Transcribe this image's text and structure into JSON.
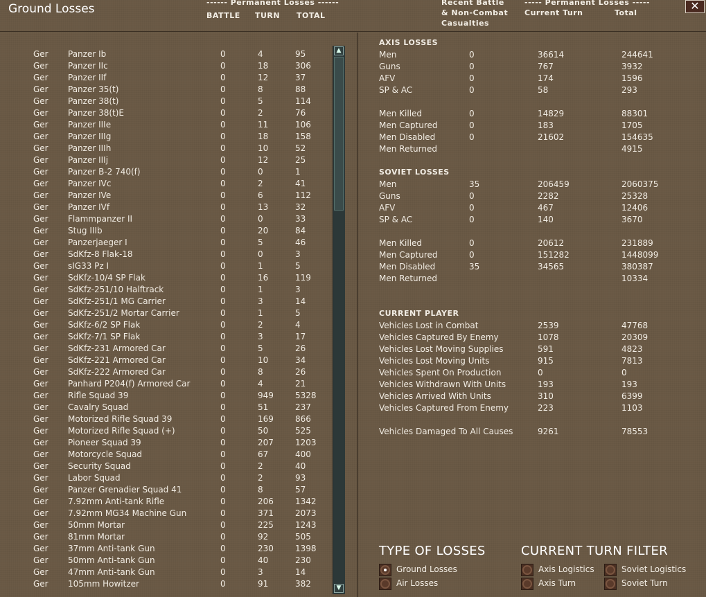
{
  "title": "Ground Losses",
  "headers": {
    "perm_left": "------ Permanent Losses ------",
    "battle": "BATTLE",
    "turn": "TURN",
    "total": "TOTAL",
    "recent_1": "Recent Battle",
    "recent_2": "& Non-Combat",
    "recent_3": "Casualties",
    "perm_right": "----- Permanent Losses -----",
    "current_turn": "Current Turn",
    "total_right": "Total"
  },
  "close_label": "✕",
  "scroll": {
    "up": "▲",
    "down": "▼"
  },
  "units": [
    {
      "nat": "Ger",
      "name": "Panzer Ib",
      "battle": "0",
      "turn": "4",
      "total": "95"
    },
    {
      "nat": "Ger",
      "name": "Panzer IIc",
      "battle": "0",
      "turn": "18",
      "total": "306"
    },
    {
      "nat": "Ger",
      "name": "Panzer IIf",
      "battle": "0",
      "turn": "12",
      "total": "37"
    },
    {
      "nat": "Ger",
      "name": "Panzer 35(t)",
      "battle": "0",
      "turn": "8",
      "total": "88"
    },
    {
      "nat": "Ger",
      "name": "Panzer 38(t)",
      "battle": "0",
      "turn": "5",
      "total": "114"
    },
    {
      "nat": "Ger",
      "name": "Panzer 38(t)E",
      "battle": "0",
      "turn": "2",
      "total": "76"
    },
    {
      "nat": "Ger",
      "name": "Panzer IIIe",
      "battle": "0",
      "turn": "11",
      "total": "106"
    },
    {
      "nat": "Ger",
      "name": "Panzer IIIg",
      "battle": "0",
      "turn": "18",
      "total": "158"
    },
    {
      "nat": "Ger",
      "name": "Panzer IIIh",
      "battle": "0",
      "turn": "10",
      "total": "52"
    },
    {
      "nat": "Ger",
      "name": "Panzer IIIj",
      "battle": "0",
      "turn": "12",
      "total": "25"
    },
    {
      "nat": "Ger",
      "name": "Panzer B-2 740(f)",
      "battle": "0",
      "turn": "0",
      "total": "1"
    },
    {
      "nat": "Ger",
      "name": "Panzer IVc",
      "battle": "0",
      "turn": "2",
      "total": "41"
    },
    {
      "nat": "Ger",
      "name": "Panzer IVe",
      "battle": "0",
      "turn": "6",
      "total": "112"
    },
    {
      "nat": "Ger",
      "name": "Panzer IVf",
      "battle": "0",
      "turn": "13",
      "total": "32"
    },
    {
      "nat": "Ger",
      "name": "Flammpanzer II",
      "battle": "0",
      "turn": "0",
      "total": "33"
    },
    {
      "nat": "Ger",
      "name": "Stug IIIb",
      "battle": "0",
      "turn": "20",
      "total": "84"
    },
    {
      "nat": "Ger",
      "name": "Panzerjaeger I",
      "battle": "0",
      "turn": "5",
      "total": "46"
    },
    {
      "nat": "Ger",
      "name": "SdKfz-8 Flak-18",
      "battle": "0",
      "turn": "0",
      "total": "3"
    },
    {
      "nat": "Ger",
      "name": "sIG33 Pz I",
      "battle": "0",
      "turn": "1",
      "total": "5"
    },
    {
      "nat": "Ger",
      "name": "SdKfz-10/4 SP Flak",
      "battle": "0",
      "turn": "16",
      "total": "119"
    },
    {
      "nat": "Ger",
      "name": "SdKfz-251/10 Halftrack",
      "battle": "0",
      "turn": "1",
      "total": "3"
    },
    {
      "nat": "Ger",
      "name": "SdKfz-251/1 MG Carrier",
      "battle": "0",
      "turn": "3",
      "total": "14"
    },
    {
      "nat": "Ger",
      "name": "SdKfz-251/2 Mortar Carrier",
      "battle": "0",
      "turn": "1",
      "total": "5"
    },
    {
      "nat": "Ger",
      "name": "SdKfz-6/2 SP Flak",
      "battle": "0",
      "turn": "2",
      "total": "4"
    },
    {
      "nat": "Ger",
      "name": "SdKfz-7/1 SP Flak",
      "battle": "0",
      "turn": "3",
      "total": "17"
    },
    {
      "nat": "Ger",
      "name": "SdKfz-231 Armored Car",
      "battle": "0",
      "turn": "5",
      "total": "26"
    },
    {
      "nat": "Ger",
      "name": "SdKfz-221 Armored Car",
      "battle": "0",
      "turn": "10",
      "total": "34"
    },
    {
      "nat": "Ger",
      "name": "SdKfz-222 Armored Car",
      "battle": "0",
      "turn": "8",
      "total": "26"
    },
    {
      "nat": "Ger",
      "name": "Panhard P204(f) Armored Car",
      "battle": "0",
      "turn": "4",
      "total": "21"
    },
    {
      "nat": "Ger",
      "name": "Rifle Squad 39",
      "battle": "0",
      "turn": "949",
      "total": "5328"
    },
    {
      "nat": "Ger",
      "name": "Cavalry Squad",
      "battle": "0",
      "turn": "51",
      "total": "237"
    },
    {
      "nat": "Ger",
      "name": "Motorized Rifle Squad 39",
      "battle": "0",
      "turn": "169",
      "total": "866"
    },
    {
      "nat": "Ger",
      "name": "Motorized Rifle Squad (+)",
      "battle": "0",
      "turn": "50",
      "total": "525"
    },
    {
      "nat": "Ger",
      "name": "Pioneer Squad 39",
      "battle": "0",
      "turn": "207",
      "total": "1203"
    },
    {
      "nat": "Ger",
      "name": "Motorcycle Squad",
      "battle": "0",
      "turn": "67",
      "total": "400"
    },
    {
      "nat": "Ger",
      "name": "Security Squad",
      "battle": "0",
      "turn": "2",
      "total": "40"
    },
    {
      "nat": "Ger",
      "name": "Labor Squad",
      "battle": "0",
      "turn": "2",
      "total": "93"
    },
    {
      "nat": "Ger",
      "name": "Panzer Grenadier Squad 41",
      "battle": "0",
      "turn": "8",
      "total": "57"
    },
    {
      "nat": "Ger",
      "name": "7.92mm Anti-tank Rifle",
      "battle": "0",
      "turn": "206",
      "total": "1342"
    },
    {
      "nat": "Ger",
      "name": "7.92mm MG34 Machine Gun",
      "battle": "0",
      "turn": "371",
      "total": "2073"
    },
    {
      "nat": "Ger",
      "name": "50mm Mortar",
      "battle": "0",
      "turn": "225",
      "total": "1243"
    },
    {
      "nat": "Ger",
      "name": "81mm Mortar",
      "battle": "0",
      "turn": "92",
      "total": "505"
    },
    {
      "nat": "Ger",
      "name": "37mm Anti-tank Gun",
      "battle": "0",
      "turn": "230",
      "total": "1398"
    },
    {
      "nat": "Ger",
      "name": "50mm Anti-tank Gun",
      "battle": "0",
      "turn": "40",
      "total": "230"
    },
    {
      "nat": "Ger",
      "name": "47mm Anti-tank Gun",
      "battle": "0",
      "turn": "3",
      "total": "14"
    },
    {
      "nat": "Ger",
      "name": "105mm Howitzer",
      "battle": "0",
      "turn": "91",
      "total": "382"
    }
  ],
  "axis": {
    "title": "AXIS LOSSES",
    "rows": [
      {
        "label": "Men",
        "recent": "0",
        "current": "36614",
        "total": "244641"
      },
      {
        "label": "Guns",
        "recent": "0",
        "current": "767",
        "total": "3932"
      },
      {
        "label": "AFV",
        "recent": "0",
        "current": "174",
        "total": "1596"
      },
      {
        "label": "SP & AC",
        "recent": "0",
        "current": "58",
        "total": "293"
      },
      {
        "label": "Men Killed",
        "recent": "0",
        "current": "14829",
        "total": "88301"
      },
      {
        "label": "Men Captured",
        "recent": "0",
        "current": "183",
        "total": "1705"
      },
      {
        "label": "Men Disabled",
        "recent": "0",
        "current": "21602",
        "total": "154635"
      },
      {
        "label": "Men Returned",
        "recent": "",
        "current": "",
        "total": "4915"
      }
    ]
  },
  "soviet": {
    "title": "SOVIET LOSSES",
    "rows": [
      {
        "label": "Men",
        "recent": "35",
        "current": "206459",
        "total": "2060375"
      },
      {
        "label": "Guns",
        "recent": "0",
        "current": "2282",
        "total": "25328"
      },
      {
        "label": "AFV",
        "recent": "0",
        "current": "467",
        "total": "12406"
      },
      {
        "label": "SP & AC",
        "recent": "0",
        "current": "140",
        "total": "3670"
      },
      {
        "label": "Men Killed",
        "recent": "0",
        "current": "20612",
        "total": "231889"
      },
      {
        "label": "Men Captured",
        "recent": "0",
        "current": "151282",
        "total": "1448099"
      },
      {
        "label": "Men Disabled",
        "recent": "35",
        "current": "34565",
        "total": "380387"
      },
      {
        "label": "Men Returned",
        "recent": "",
        "current": "",
        "total": "10334"
      }
    ]
  },
  "player": {
    "title": "CURRENT PLAYER",
    "rows": [
      {
        "label": "Vehicles Lost in Combat",
        "current": "2539",
        "total": "47768"
      },
      {
        "label": "Vehicles Captured By Enemy",
        "current": "1078",
        "total": "20309"
      },
      {
        "label": "Vehicles Lost Moving Supplies",
        "current": "591",
        "total": "4823"
      },
      {
        "label": "Vehicles Lost Moving Units",
        "current": "915",
        "total": "7813"
      },
      {
        "label": "Vehicles Spent On Production",
        "current": "0",
        "total": "0"
      },
      {
        "label": "Vehicles Withdrawn With Units",
        "current": "193",
        "total": "193"
      },
      {
        "label": "Vehicles Arrived With Units",
        "current": "310",
        "total": "6399"
      },
      {
        "label": "Vehicles Captured From Enemy",
        "current": "223",
        "total": "1103"
      },
      {
        "label": "Vehicles Damaged To All Causes",
        "current": "9261",
        "total": "78553"
      }
    ]
  },
  "type_of_losses": {
    "title": "TYPE OF LOSSES",
    "options": [
      "Ground Losses",
      "Air Losses"
    ],
    "selected": "Ground Losses"
  },
  "turn_filter": {
    "title": "CURRENT TURN FILTER",
    "options": [
      "Axis Logistics",
      "Soviet Logistics",
      "Axis Turn",
      "Soviet Turn"
    ]
  }
}
